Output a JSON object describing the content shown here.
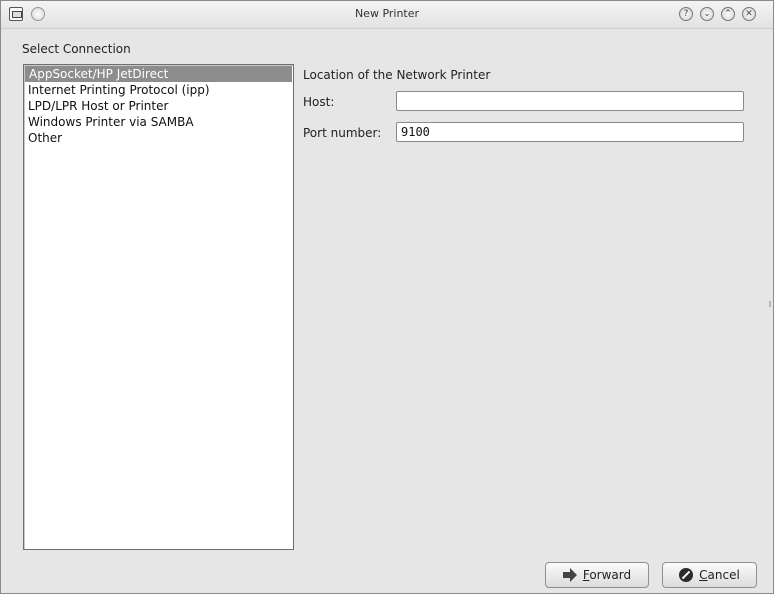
{
  "window": {
    "title": "New Printer",
    "controls": [
      "help-icon",
      "minimize-icon",
      "maximize-icon",
      "close-icon"
    ],
    "control_glyphs": {
      "help": "?",
      "minimize": "⌄",
      "maximize": "⌃",
      "close": "✕"
    }
  },
  "sidebar": {
    "heading": "Select Connection",
    "items": [
      {
        "label": "AppSocket/HP JetDirect",
        "selected": true
      },
      {
        "label": "Internet Printing Protocol (ipp)",
        "selected": false
      },
      {
        "label": "LPD/LPR Host or Printer",
        "selected": false
      },
      {
        "label": "Windows Printer via SAMBA",
        "selected": false
      },
      {
        "label": "Other",
        "selected": false
      }
    ]
  },
  "main": {
    "title": "Location of the Network Printer",
    "host_label": "Host:",
    "host_value": "",
    "port_label": "Port number:",
    "port_value": "9100"
  },
  "footer": {
    "forward_label": "Forward",
    "cancel_label": "Cancel"
  },
  "colors": {
    "window_bg": "#e6e6e6",
    "selection_bg": "#8d8d8d",
    "selection_text": "#ffffff"
  }
}
